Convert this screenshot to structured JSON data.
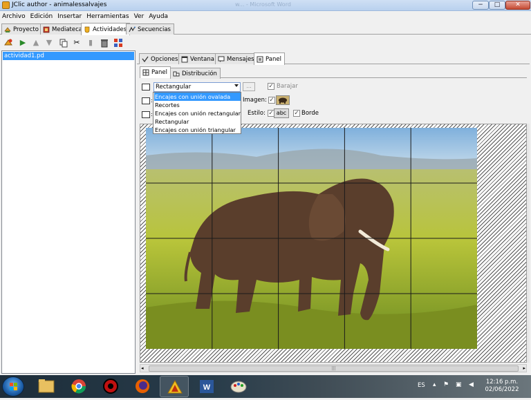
{
  "window": {
    "title": "JClic author - animalessalvajes",
    "background_title": "w... - Microsoft Word",
    "minimize": "−",
    "maximize": "□",
    "close": "✕"
  },
  "menu": [
    "Archivo",
    "Edición",
    "Insertar",
    "Herramientas",
    "Ver",
    "Ayuda"
  ],
  "main_tabs": [
    "Proyecto",
    "Mediateca",
    "Actividades",
    "Secuencias"
  ],
  "active_main_tab": "Actividades",
  "activities": [
    "actividad1.pd"
  ],
  "sub_tabs": [
    "Opciones",
    "Ventana",
    "Mensajes",
    "Panel"
  ],
  "active_sub_tab": "Panel",
  "panel_tabs": [
    "Panel",
    "Distribución"
  ],
  "active_panel_tab": "Panel",
  "layout_combo": {
    "value": "Rectangular",
    "options": [
      "Encajes con unión ovalada",
      "Recortes",
      "Encajes con unión rectangular",
      "Rectangular",
      "Encajes con unión triangular"
    ],
    "highlighted": "Encajes con unión ovalada"
  },
  "dots_button": "...",
  "barajar": {
    "label": "Barajar",
    "checked": true
  },
  "imagen": {
    "label": "Imagen:",
    "checked": true
  },
  "estilo": {
    "label": "Estilo:",
    "checked": true,
    "sample": "abc"
  },
  "borde": {
    "label": "Borde",
    "checked": true
  },
  "grid": {
    "columns": 5,
    "rows": 4
  },
  "scroll_thumb": "|||",
  "taskbar": {
    "apps": [
      "explorer",
      "chrome",
      "app-red",
      "firefox",
      "autocad",
      "word",
      "paint"
    ],
    "language": "ES",
    "time": "12:16 p.m.",
    "date": "02/06/2022"
  },
  "colors": {
    "selection": "#3399ff",
    "taskbar": "#1d2d3a"
  }
}
